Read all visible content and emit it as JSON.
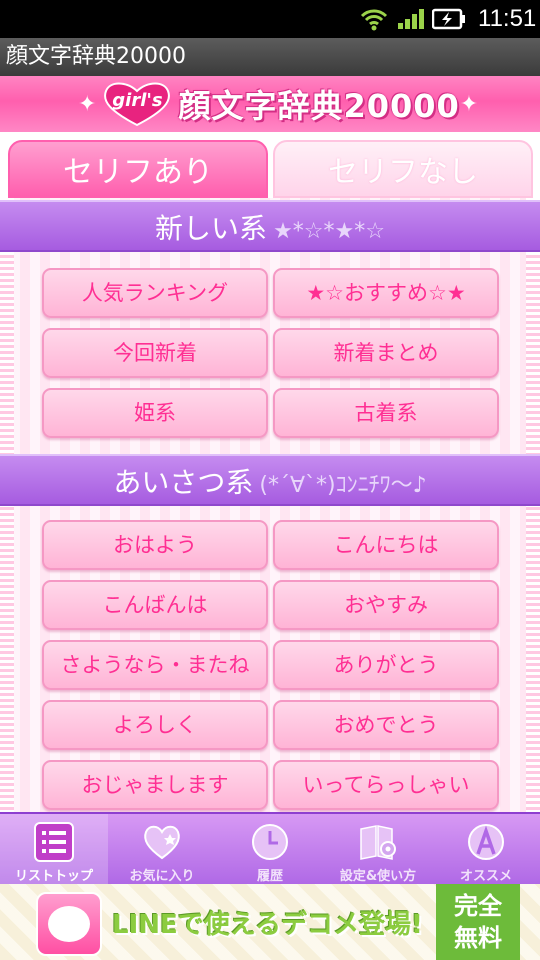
{
  "status_bar": {
    "time": "11:51"
  },
  "title_bar": {
    "title": "顔文字辞典20000"
  },
  "banner": {
    "heart_label": "girl's",
    "title": "顔文字辞典20000",
    "sparkle_left": "✦",
    "sparkle_right": "✦"
  },
  "tabs": [
    {
      "label": "セリフあり",
      "active": true
    },
    {
      "label": "セリフなし",
      "active": false
    }
  ],
  "sections": [
    {
      "title": "新しい系",
      "deco": "★*☆*★*☆",
      "buttons": [
        "人気ランキング",
        "★☆おすすめ☆★",
        "今回新着",
        "新着まとめ",
        "姫系",
        "古着系"
      ]
    },
    {
      "title": "あいさつ系",
      "deco": "(*´∀`*)ｺﾝﾆﾁﾜ〜♪",
      "buttons": [
        "おはよう",
        "こんにちは",
        "こんばんは",
        "おやすみ",
        "さようなら・またね",
        "ありがとう",
        "よろしく",
        "おめでとう",
        "おじゃまします",
        "いってらっしゃい"
      ]
    }
  ],
  "bottom_nav": [
    {
      "label": "リストトップ",
      "icon": "list-icon",
      "active": true
    },
    {
      "label": "お気に入り",
      "icon": "heart-icon",
      "active": false
    },
    {
      "label": "履歴",
      "icon": "clock-icon",
      "active": false
    },
    {
      "label": "設定&使い方",
      "icon": "book-gear-icon",
      "active": false
    },
    {
      "label": "オススメ",
      "icon": "recommend-icon",
      "active": false
    }
  ],
  "ad": {
    "text": "LINEで使えるデコメ登場!",
    "free_line1": "完全",
    "free_line2": "無料"
  },
  "colors": {
    "pink": "#ff5fae",
    "purple": "#a65ce0",
    "button_text": "#ff2f93"
  }
}
